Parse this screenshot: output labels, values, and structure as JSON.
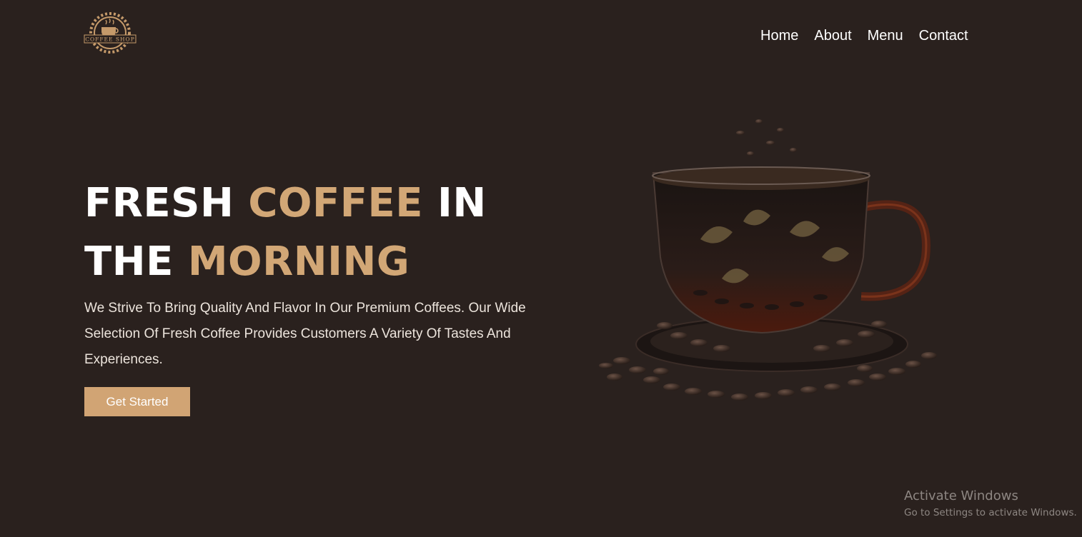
{
  "brand": {
    "logo_text": "COFFEE SHOP",
    "accent_color": "#d2a776",
    "background_color": "#2a211e"
  },
  "nav": {
    "items": [
      {
        "label": "Home"
      },
      {
        "label": "About"
      },
      {
        "label": "Menu"
      },
      {
        "label": "Contact"
      }
    ]
  },
  "hero": {
    "title_line1_a": "FRESH",
    "title_line1_b": "COFFEE",
    "title_line1_c": "IN",
    "title_line2_a": "THE",
    "title_line2_b": "MORNING",
    "description": "We Strive To Bring Quality And Flavor In Our Premium Coffees. Our Wide Selection Of Fresh Coffee Provides Customers A Variety Of Tastes And Experiences.",
    "cta_label": "Get Started"
  },
  "watermark": {
    "title": "Activate Windows",
    "subtitle": "Go to Settings to activate Windows."
  }
}
